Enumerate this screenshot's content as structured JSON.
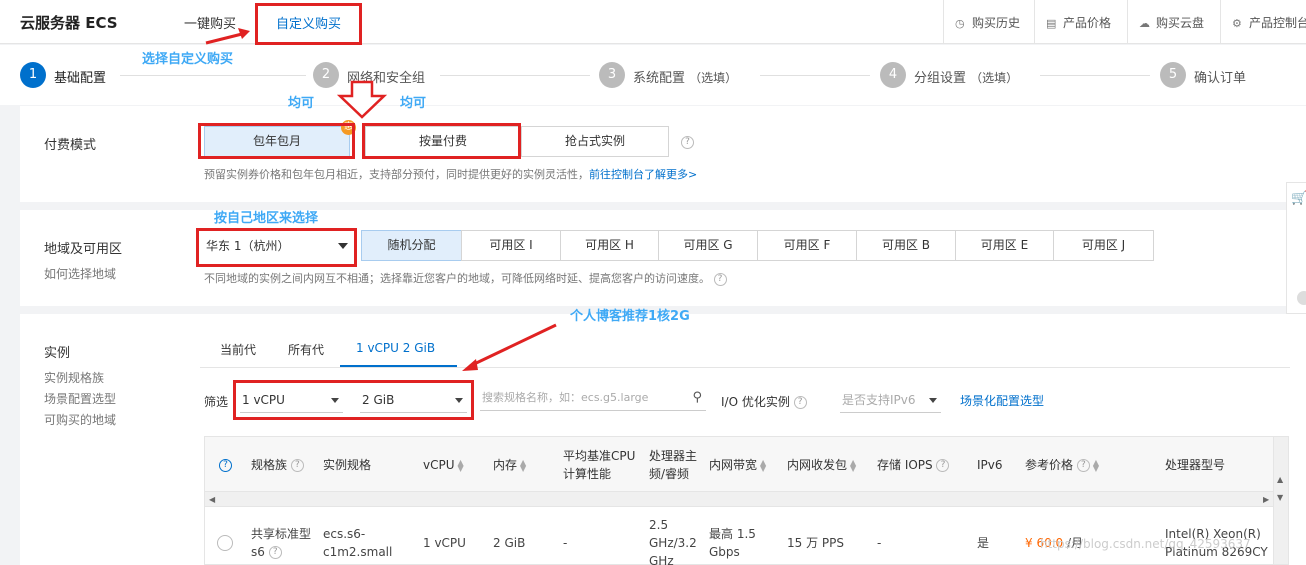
{
  "header": {
    "app_title": "云服务器 ECS",
    "tab_one_click": "一键购买",
    "tab_custom": "自定义购买",
    "links": {
      "history": "购买历史",
      "pricing": "产品价格",
      "disk": "购买云盘",
      "console": "产品控制台"
    }
  },
  "steps": [
    {
      "num": "1",
      "label": "基础配置"
    },
    {
      "num": "2",
      "label": "网络和安全组"
    },
    {
      "num": "3",
      "label": "系统配置",
      "suffix": "（选填）"
    },
    {
      "num": "4",
      "label": "分组设置",
      "suffix": "（选填）"
    },
    {
      "num": "5",
      "label": "确认订单"
    }
  ],
  "billing": {
    "title": "付费模式",
    "options": [
      "包年包月",
      "按量付费",
      "抢占式实例"
    ],
    "badge": "惠",
    "hint": "预留实例券价格和包年包月相近，支持部分预付，同时提供更好的实例灵活性，",
    "hint_link": "前往控制台了解更多>"
  },
  "region": {
    "title": "地域及可用区",
    "subtitle": "如何选择地域",
    "selected": "华东 1（杭州）",
    "zones": [
      "随机分配",
      "可用区 I",
      "可用区 H",
      "可用区 G",
      "可用区 F",
      "可用区 B",
      "可用区 E",
      "可用区 J"
    ],
    "hint": "不同地域的实例之间内网互不相通；选择靠近您客户的地域，可降低网络时延、提高您客户的访问速度。"
  },
  "instance": {
    "title": "实例",
    "side_links": [
      "实例规格族",
      "场景配置选型",
      "可购买的地域"
    ],
    "tabs": [
      "当前代",
      "所有代",
      "1 vCPU 2 GiB"
    ],
    "filter_label": "筛选",
    "vcpu_value": "1 vCPU",
    "mem_value": "2 GiB",
    "search_placeholder": "搜索规格名称，如：ecs.g5.large",
    "io_label": "I/O 优化实例",
    "ipv6_placeholder": "是否支持IPv6",
    "scene_link": "场景化配置选型"
  },
  "table": {
    "headers": {
      "family": "规格族",
      "spec": "实例规格",
      "vcpu": "vCPU",
      "mem": "内存",
      "baseline_1": "平均基准CPU",
      "baseline_2": "计算性能",
      "cpu_freq_1": "处理器主",
      "cpu_freq_2": "频/睿频",
      "bandwidth": "内网带宽",
      "pps": "内网收发包",
      "iops": "存储 IOPS",
      "ipv6": "IPv6",
      "price": "参考价格",
      "cpu_model": "处理器型号"
    },
    "row": {
      "family_1": "共享标准型",
      "family_2": "s6",
      "spec_1": "ecs.s6-",
      "spec_2": "c1m2.small",
      "vcpu": "1 vCPU",
      "mem": "2 GiB",
      "baseline": "-",
      "freq_1": "2.5",
      "freq_2": "GHz/3.2",
      "freq_3": "GHz",
      "bw_1": "最高 1.5",
      "bw_2": "Gbps",
      "pps": "15 万 PPS",
      "iops": "-",
      "ipv6": "是",
      "price": "¥ 60.0",
      "price_unit": "/月",
      "cpu_model_1": "Intel(R) Xeon(R)",
      "cpu_model_2": "Platinum 8269CY"
    }
  },
  "annotations": {
    "custom_buy": "选择自定义购买",
    "either_1": "均可",
    "either_2": "均可",
    "region": "按自己地区来选择",
    "recommend": "个人博客推荐1核2G"
  },
  "watermark": "https://blog.csdn.net/qq_42593637",
  "colors": {
    "accent": "#0070cc",
    "annotation_red": "#e02222",
    "annotation_text": "#3fa9f5",
    "price": "#ff6600",
    "badge": "#f59a23"
  }
}
